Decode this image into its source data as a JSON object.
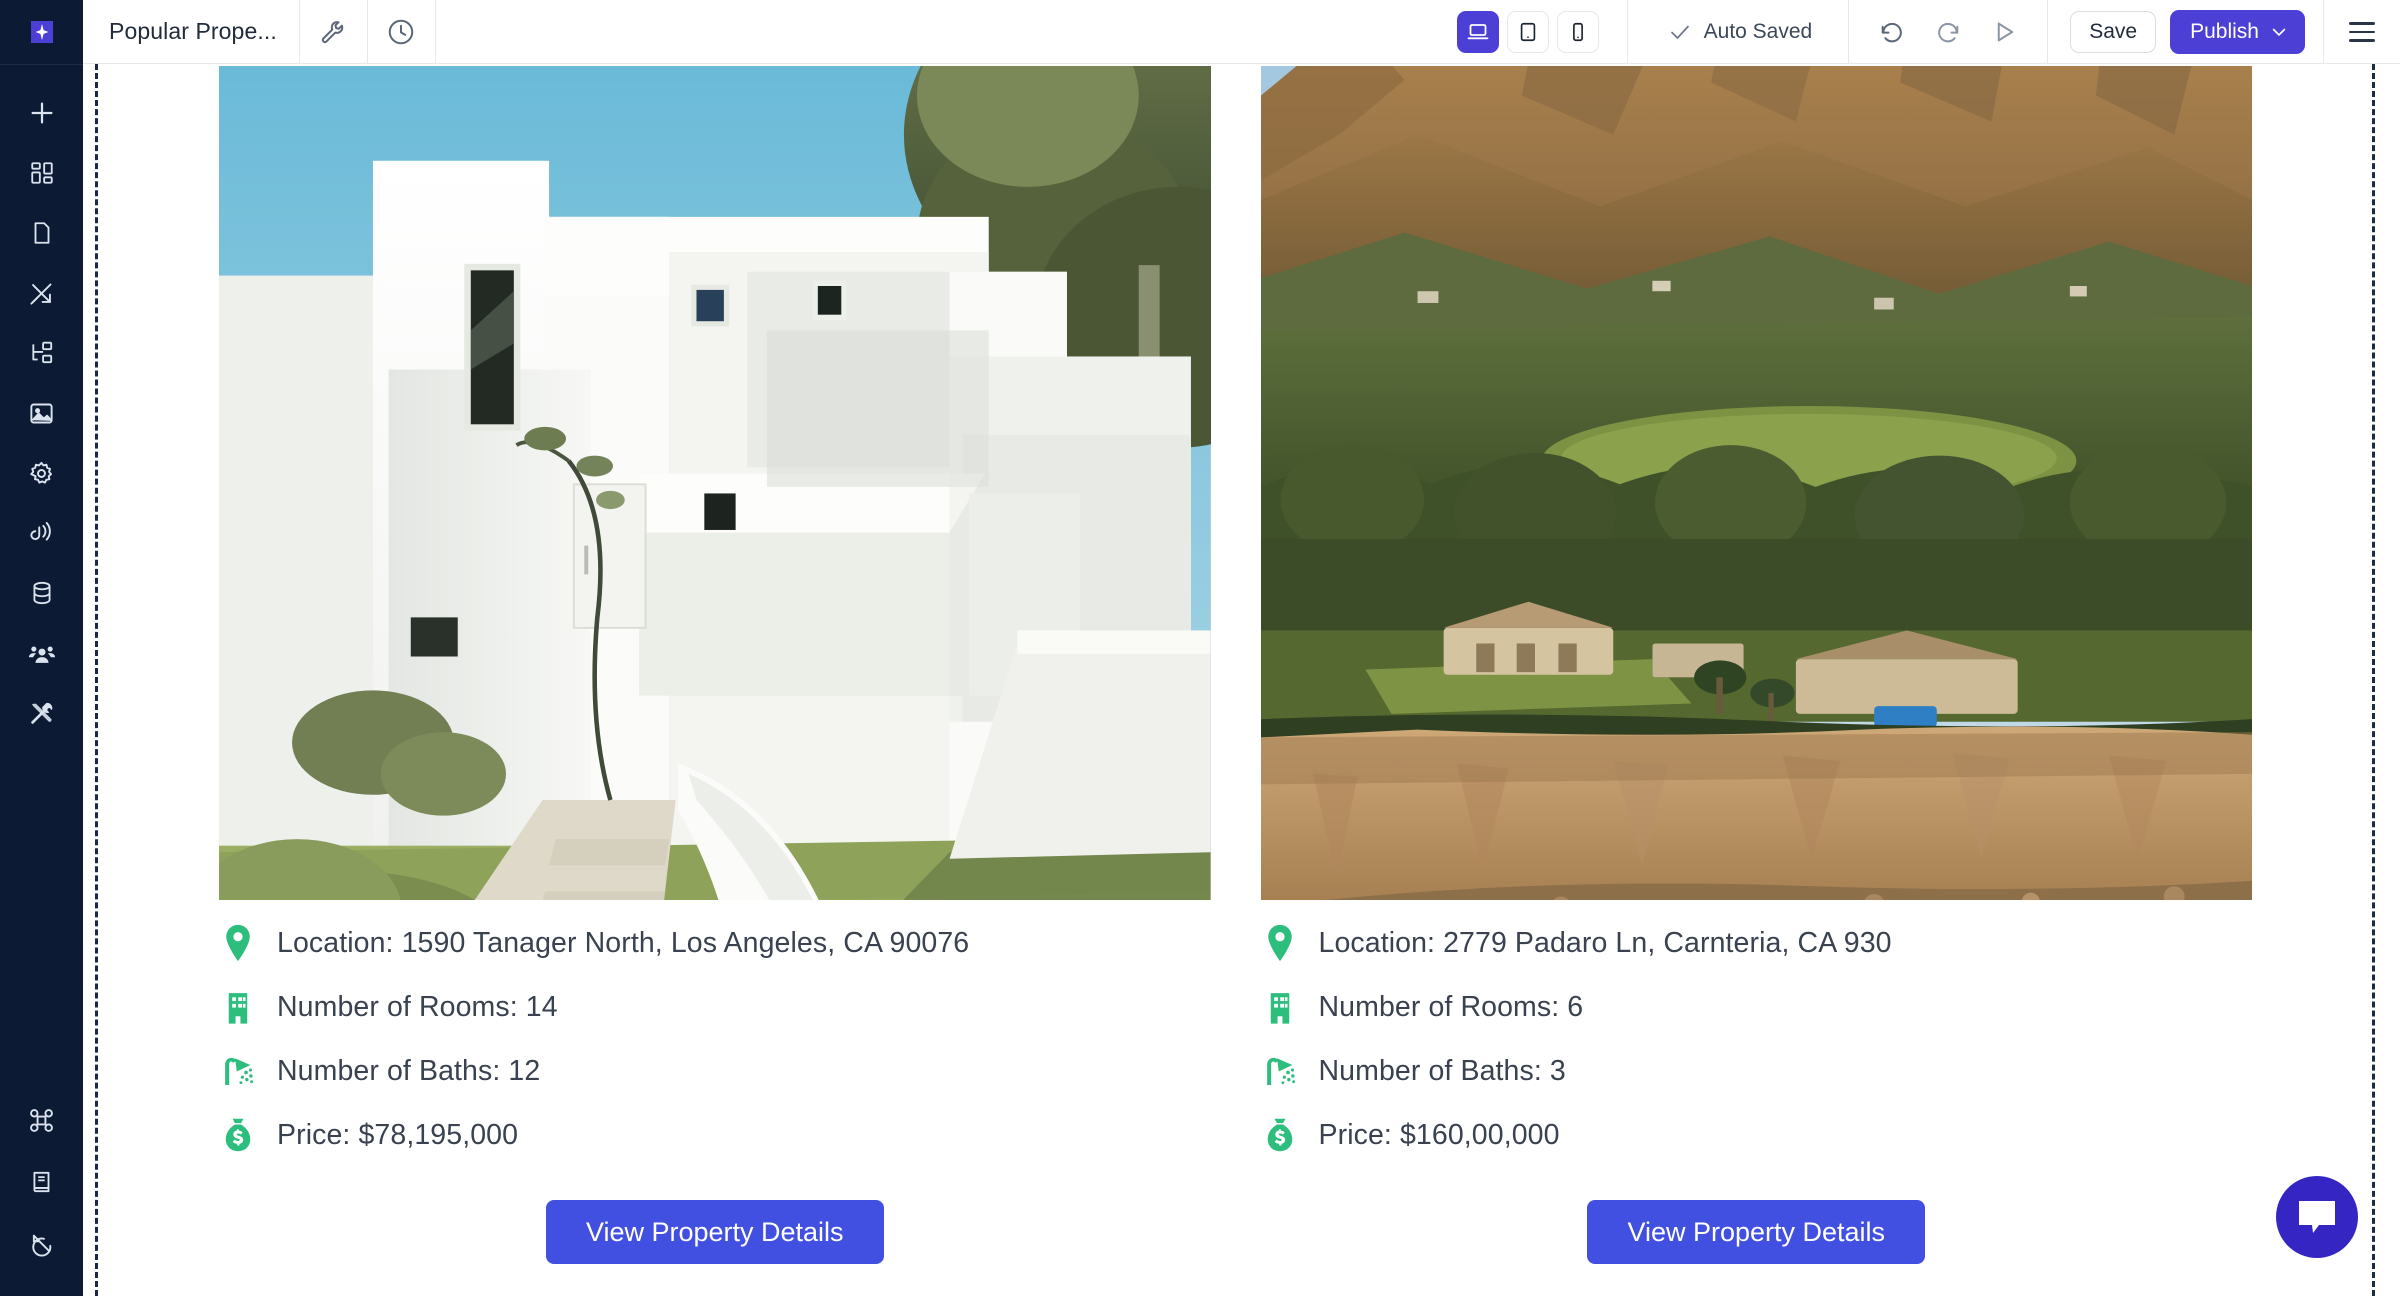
{
  "header": {
    "logo_name": "app-logo",
    "project_title": "Popular Prope...",
    "tools_icon": "wrench-icon",
    "history_icon": "clock-icon",
    "devices": [
      {
        "name": "desktop",
        "icon": "laptop-icon",
        "active": true
      },
      {
        "name": "tablet",
        "icon": "tablet-icon",
        "active": false
      },
      {
        "name": "mobile",
        "icon": "mobile-icon",
        "active": false
      }
    ],
    "autosave_label": "Auto Saved",
    "autosave_icon": "check-icon",
    "undo_icon": "undo-icon",
    "redo_icon": "redo-icon",
    "preview_icon": "play-icon",
    "save_label": "Save",
    "publish_label": "Publish",
    "publish_chevron": "chevron-down-icon",
    "menu_icon": "hamburger-icon"
  },
  "sidebar": {
    "items": [
      {
        "name": "add",
        "icon": "plus-icon"
      },
      {
        "name": "components",
        "icon": "blocks-icon"
      },
      {
        "name": "pages",
        "icon": "page-icon"
      },
      {
        "name": "design",
        "icon": "pen-brush-icon"
      },
      {
        "name": "layers",
        "icon": "tree-structure-icon"
      },
      {
        "name": "media",
        "icon": "image-icon"
      },
      {
        "name": "settings",
        "icon": "gear-icon"
      },
      {
        "name": "integrations",
        "icon": "broadcast-icon"
      },
      {
        "name": "database",
        "icon": "database-icon"
      },
      {
        "name": "team",
        "icon": "users-icon"
      },
      {
        "name": "tools",
        "icon": "tools-icon"
      }
    ],
    "bottom_items": [
      {
        "name": "shortcuts",
        "icon": "command-icon"
      },
      {
        "name": "docs",
        "icon": "book-icon"
      },
      {
        "name": "updates",
        "icon": "history-arrow-icon"
      }
    ]
  },
  "colors": {
    "brand_purple": "#4b3fd6",
    "cta_blue": "#4150e0",
    "accent_green": "#2dbe7e",
    "rail_navy": "#0c1b33",
    "text_dark": "#3a4250"
  },
  "canvas": {
    "section_name": "popular-properties",
    "properties": [
      {
        "photo_alt": "modern-white-villa-exterior",
        "features": [
          {
            "icon": "location-pin-icon",
            "text": "Location: 1590 Tanager North, Los Angeles, CA 90076"
          },
          {
            "icon": "building-icon",
            "text": "Number of Rooms: 14"
          },
          {
            "icon": "shower-icon",
            "text": "Number of Baths: 12"
          },
          {
            "icon": "money-bag-icon",
            "text": "Price: $78,195,000"
          }
        ],
        "cta_label": "View Property Details"
      },
      {
        "photo_alt": "coastal-cliffside-estate-aerial",
        "features": [
          {
            "icon": "location-pin-icon",
            "text": "Location: 2779 Padaro Ln, Carnteria, CA 930"
          },
          {
            "icon": "building-icon",
            "text": "Number of Rooms: 6"
          },
          {
            "icon": "shower-icon",
            "text": "Number of Baths: 3"
          },
          {
            "icon": "money-bag-icon",
            "text": "Price: $160,00,000"
          }
        ],
        "cta_label": "View Property Details"
      }
    ]
  },
  "chat": {
    "name": "chat-widget",
    "icon": "chat-bubble-icon"
  }
}
